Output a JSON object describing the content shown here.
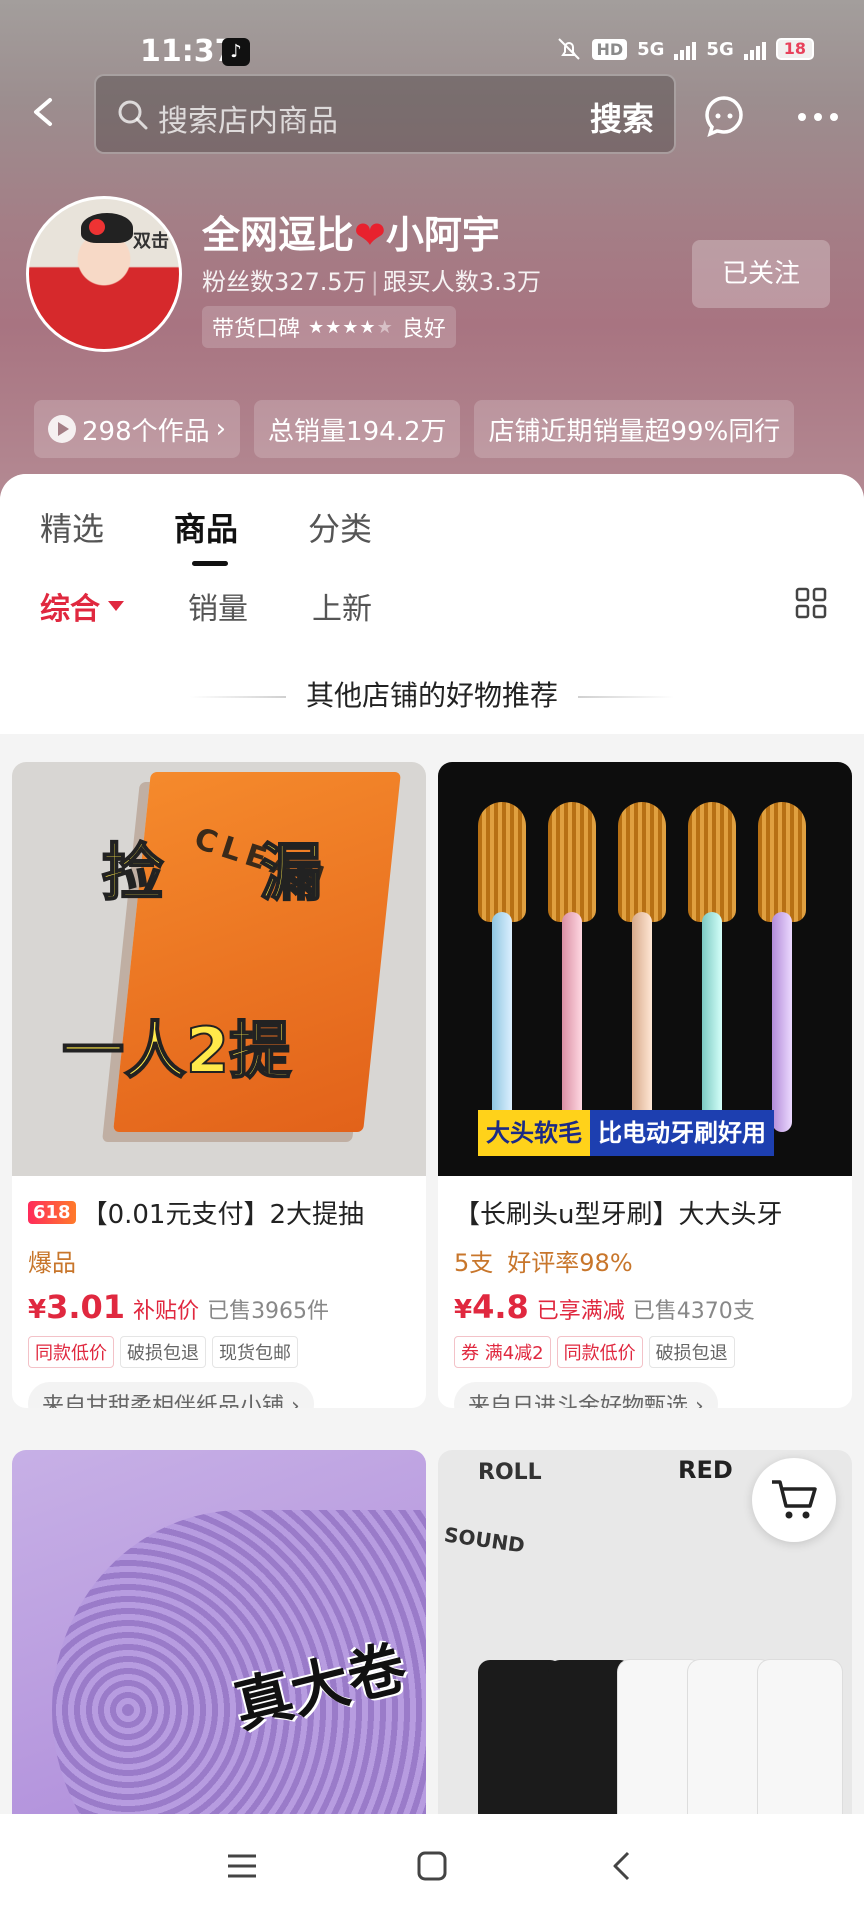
{
  "status": {
    "time": "11:37",
    "hd": "HD",
    "net1": "5G",
    "net2": "5G",
    "battery": "18"
  },
  "search": {
    "placeholder": "搜索店内商品",
    "button": "搜索"
  },
  "profile": {
    "avatar_text": "双击",
    "name_left": "全网逗比",
    "name_right": "小阿宇",
    "fans": "粉丝数327.5万",
    "followers": "跟买人数3.3万",
    "rep_label": "带货口碑",
    "rep_value": "良好",
    "rep_stars": 4,
    "follow_button": "已关注"
  },
  "chips": [
    "298个作品",
    "总销量194.2万",
    "店铺近期销量超99%同行"
  ],
  "tabs": [
    "精选",
    "商品",
    "分类"
  ],
  "sorts": [
    "综合",
    "销量",
    "上新"
  ],
  "recommend_title": "其他店铺的好物推荐",
  "products": [
    {
      "badge": "618",
      "title": "【0.01元支付】2大提抽",
      "line2": "爆品",
      "line2_extra": "",
      "price_symbol": "¥",
      "price": "3.01",
      "price_tag": "补贴价",
      "sold": "已售3965件",
      "tags": [
        "同款低价",
        "破损包退",
        "现货包邮"
      ],
      "store": "来自甘甜柔相伴纸品小铺 ›",
      "img_text_1": "捡",
      "img_text_2": "漏",
      "img_text_3": "一人2提",
      "img_brand": "CLEAN"
    },
    {
      "badge": "",
      "title": "【长刷头u型牙刷】大大头牙",
      "line2": "5支",
      "line2_extra": "好评率98%",
      "price_symbol": "¥",
      "price": "4.8",
      "price_tag": "已享满减",
      "sold": "已售4370支",
      "tags": [
        "券 满4减2",
        "同款低价",
        "破损包退"
      ],
      "store": "来自日进斗金好物甄选 ›",
      "img_banner_1": "大头软毛",
      "img_banner_2": "比电动牙刷好用"
    },
    {
      "img_text": "真大卷"
    },
    {
      "img_label_1": "ROLL",
      "img_label_2": "SOUND",
      "img_label_3": "RED"
    }
  ]
}
